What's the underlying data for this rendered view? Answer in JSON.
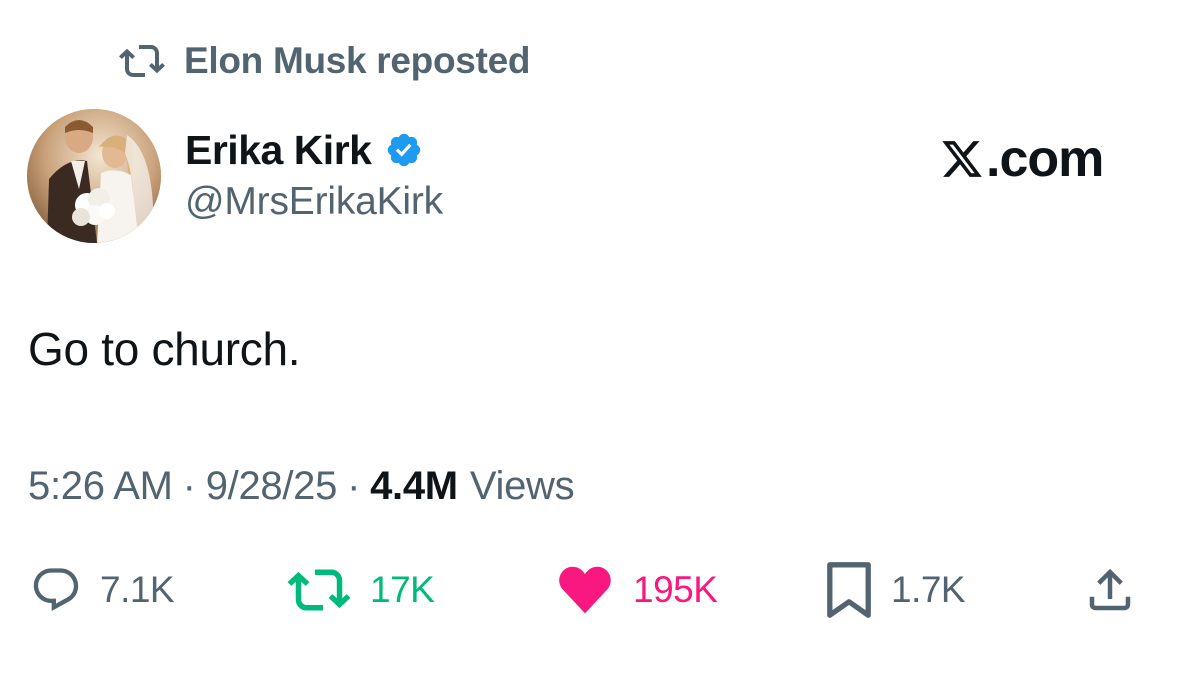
{
  "repost": {
    "icon": "repost-icon",
    "text": "Elon Musk reposted"
  },
  "author": {
    "avatar": "avatar-photo",
    "display_name": "Erika Kirk",
    "verified_icon": "verified-badge-icon",
    "handle": "@MrsErikaKirk"
  },
  "brand": {
    "logo_icon": "x-logo-icon",
    "suffix": ".com"
  },
  "tweet": {
    "text": "Go to church."
  },
  "meta": {
    "time": "5:26 AM",
    "separator": "·",
    "date": "9/28/25",
    "views_count": "4.4M",
    "views_label": "Views"
  },
  "actions": {
    "reply": {
      "icon": "reply-icon",
      "count": "7.1K"
    },
    "retweet": {
      "icon": "retweet-icon",
      "count": "17K",
      "color": "#00ba7c"
    },
    "like": {
      "icon": "heart-icon",
      "count": "195K",
      "color": "#f91880"
    },
    "bookmark": {
      "icon": "bookmark-icon",
      "count": "1.7K"
    },
    "share": {
      "icon": "share-icon"
    }
  },
  "colors": {
    "text_primary": "#0f1419",
    "text_secondary": "#536471",
    "verified_blue": "#1d9bf0"
  }
}
